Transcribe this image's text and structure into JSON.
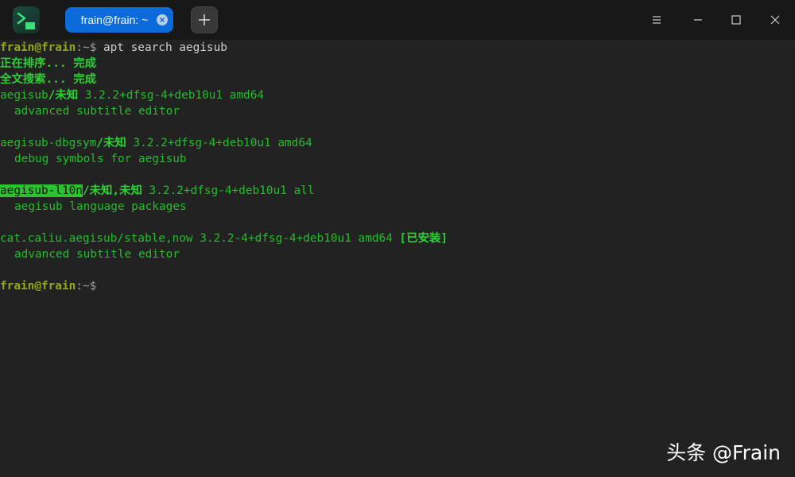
{
  "tab": {
    "label": "frain@frain: ~"
  },
  "prompt": {
    "user": "frain@frain",
    "sep": ":~$ "
  },
  "command": "apt search aegisub",
  "status": [
    "正在排序... 完成",
    "全文搜索... 完成"
  ],
  "packages": [
    {
      "name": "aegisub",
      "source": "/未知",
      "version": " 3.2.2+dfsg-4+deb10u1 amd64",
      "desc": "advanced subtitle editor"
    },
    {
      "name": "aegisub-dbgsym",
      "source": "/未知",
      "version": " 3.2.2+dfsg-4+deb10u1 amd64",
      "desc": "debug symbols for aegisub"
    },
    {
      "name": "aegisub-l10n",
      "source": "/未知,未知",
      "version": " 3.2.2+dfsg-4+deb10u1 all",
      "desc": "aegisub language packages"
    },
    {
      "name": "cat.caliu.aegisub",
      "source": "/stable,now",
      "version": " 3.2.2-4+dfsg-4+deb10u1 amd64 ",
      "installed": "[已安装]",
      "desc": "advanced subtitle editor"
    }
  ],
  "watermark": "头条 @Frain",
  "colors": {
    "terminal_bg": "#222222",
    "titlebar_bg": "#181818",
    "tab_active": "#0a6bd9",
    "text_green": "#21be2a",
    "prompt_olive": "#8fa81a"
  },
  "icons": {
    "app": "terminal-app-icon",
    "tab_close": "close-icon",
    "new_tab": "plus-icon",
    "menu": "hamburger-icon",
    "minimize": "minimize-icon",
    "maximize": "maximize-icon",
    "close": "close-icon"
  }
}
